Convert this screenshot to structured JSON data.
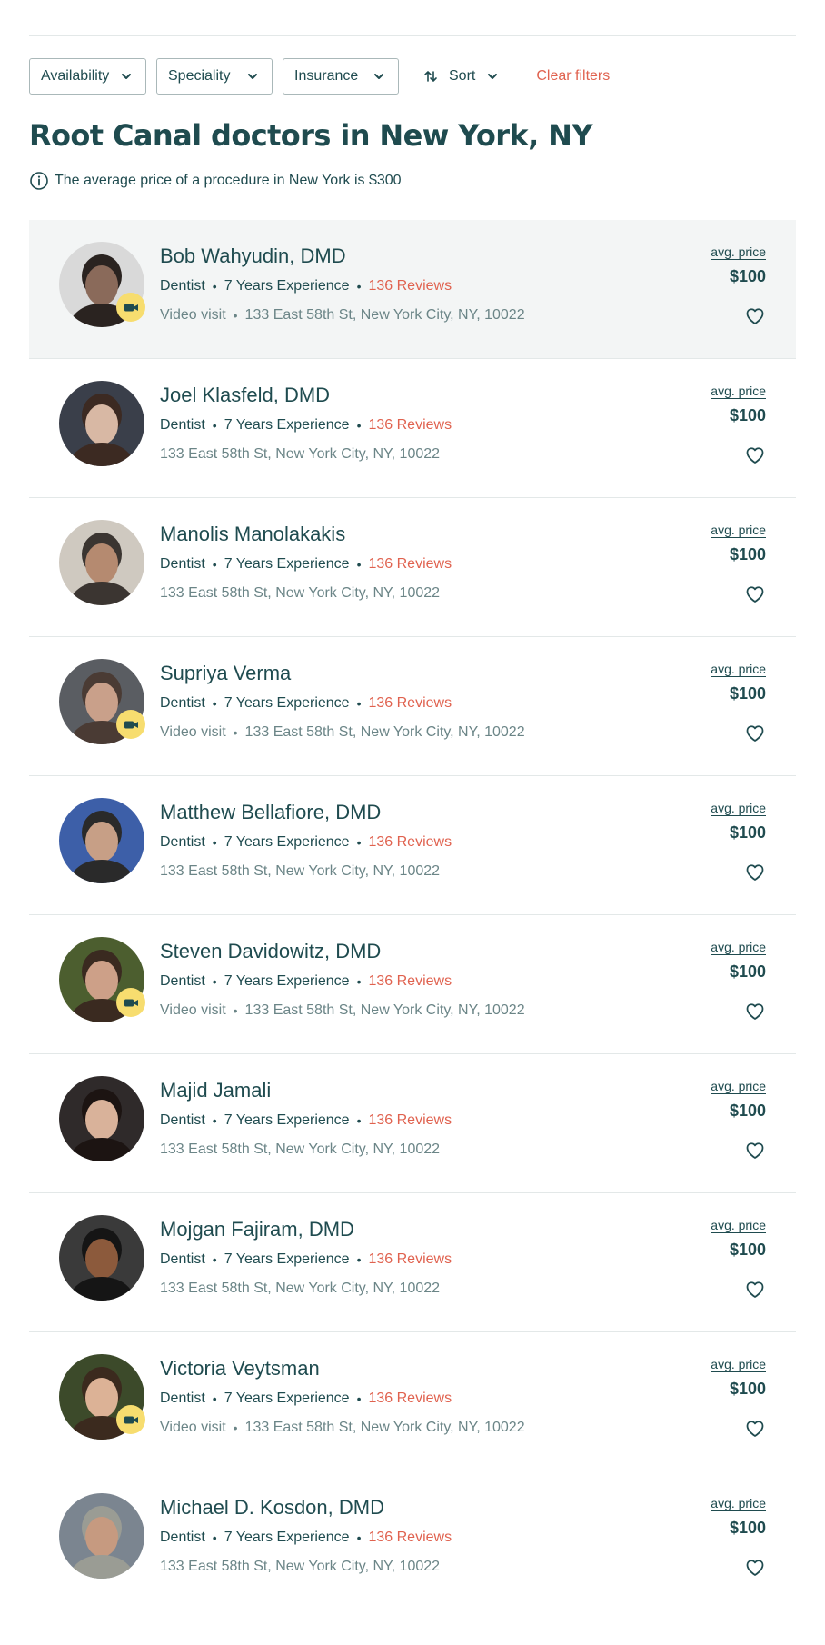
{
  "filters": {
    "availability": "Availability",
    "speciality": "Speciality",
    "insurance": "Insurance",
    "sort": "Sort",
    "clear": "Clear filters"
  },
  "title": "Root Canal doctors in New York, NY",
  "avg_note": "The average price of a procedure in New York is $300",
  "colors": {
    "primary_text": "#1f4b4f",
    "accent": "#e0624f",
    "muted": "#6b8587",
    "video_badge": "#f7dd6f",
    "row_highlight": "#f3f5f5"
  },
  "doctors": [
    {
      "name": "Bob Wahyudin, DMD",
      "specialty": "Dentist",
      "experience": "7 Years Experience",
      "reviews": "136 Reviews",
      "video": "Video visit",
      "address": "133 East 58th St, New York City, NY, 10022",
      "price_label": "avg. price",
      "price": "$100"
    },
    {
      "name": "Joel Klasfeld, DMD",
      "specialty": "Dentist",
      "experience": "7 Years Experience",
      "reviews": "136 Reviews",
      "video": "",
      "address": "133 East 58th St, New York City, NY, 10022",
      "price_label": "avg. price",
      "price": "$100"
    },
    {
      "name": "Manolis Manolakakis",
      "specialty": "Dentist",
      "experience": "7 Years Experience",
      "reviews": "136 Reviews",
      "video": "",
      "address": "133 East 58th St, New York City, NY, 10022",
      "price_label": "avg. price",
      "price": "$100"
    },
    {
      "name": "Supriya Verma",
      "specialty": "Dentist",
      "experience": "7 Years Experience",
      "reviews": "136 Reviews",
      "video": "Video visit",
      "address": "133 East 58th St, New York City, NY, 10022",
      "price_label": "avg. price",
      "price": "$100"
    },
    {
      "name": "Matthew Bellafiore, DMD",
      "specialty": "Dentist",
      "experience": "7 Years Experience",
      "reviews": "136 Reviews",
      "video": "",
      "address": "133 East 58th St, New York City, NY, 10022",
      "price_label": "avg. price",
      "price": "$100"
    },
    {
      "name": "Steven Davidowitz, DMD",
      "specialty": "Dentist",
      "experience": "7 Years Experience",
      "reviews": "136 Reviews",
      "video": "Video visit",
      "address": "133 East 58th St, New York City, NY, 10022",
      "price_label": "avg. price",
      "price": "$100"
    },
    {
      "name": "Majid Jamali",
      "specialty": "Dentist",
      "experience": "7 Years Experience",
      "reviews": "136 Reviews",
      "video": "",
      "address": "133 East 58th St, New York City, NY, 10022",
      "price_label": "avg. price",
      "price": "$100"
    },
    {
      "name": "Mojgan Fajiram, DMD",
      "specialty": "Dentist",
      "experience": "7 Years Experience",
      "reviews": "136 Reviews",
      "video": "",
      "address": "133 East 58th St, New York City, NY, 10022",
      "price_label": "avg. price",
      "price": "$100"
    },
    {
      "name": "Victoria Veytsman",
      "specialty": "Dentist",
      "experience": "7 Years Experience",
      "reviews": "136 Reviews",
      "video": "Video visit",
      "address": "133 East 58th St, New York City, NY, 10022",
      "price_label": "avg. price",
      "price": "$100"
    },
    {
      "name": "Michael D. Kosdon, DMD",
      "specialty": "Dentist",
      "experience": "7 Years Experience",
      "reviews": "136 Reviews",
      "video": "",
      "address": "133 East 58th St, New York City, NY, 10022",
      "price_label": "avg. price",
      "price": "$100"
    }
  ]
}
